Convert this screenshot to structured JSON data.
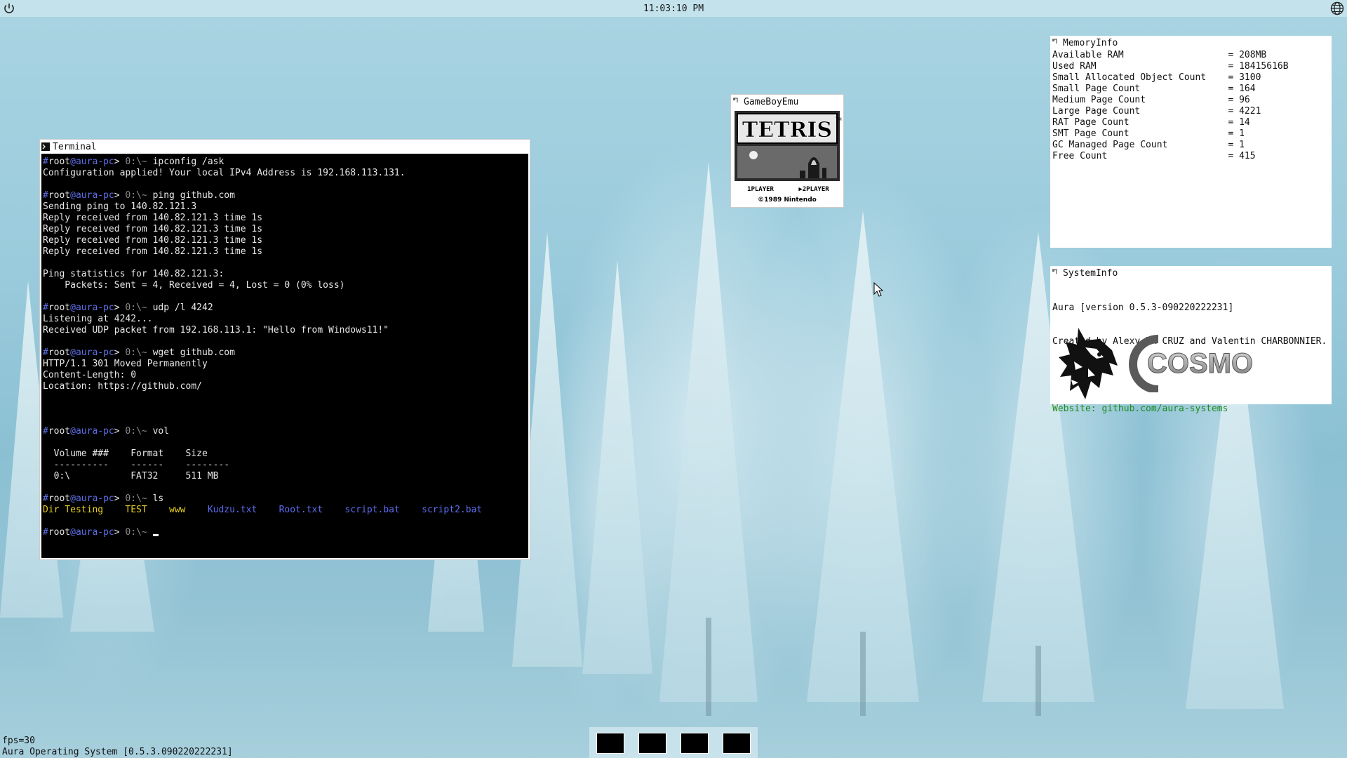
{
  "topbar": {
    "clock": "11:03:10 PM",
    "power_icon": "power-icon",
    "globe_icon": "globe-icon"
  },
  "terminal": {
    "title": "Terminal",
    "prompt": {
      "hash": "#",
      "user": "root",
      "host": "@aura-pc",
      "sep": ">",
      "path": " 0:\\~ "
    },
    "blocks": [
      {
        "cmd": "ipconfig /ask",
        "output": [
          "Configuration applied! Your local IPv4 Address is 192.168.113.131."
        ]
      },
      {
        "cmd": "ping github.com",
        "output": [
          "Sending ping to 140.82.121.3",
          "Reply received from 140.82.121.3 time 1s",
          "Reply received from 140.82.121.3 time 1s",
          "Reply received from 140.82.121.3 time 1s",
          "Reply received from 140.82.121.3 time 1s",
          "",
          "Ping statistics for 140.82.121.3:",
          "    Packets: Sent = 4, Received = 4, Lost = 0 (0% loss)"
        ]
      },
      {
        "cmd": "udp /l 4242",
        "output": [
          "Listening at 4242...",
          "Received UDP packet from 192.168.113.1: \"Hello from Windows11!\""
        ]
      },
      {
        "cmd": "wget github.com",
        "output": [
          "HTTP/1.1 301 Moved Permanently",
          "Content-Length: 0",
          "Location: https://github.com/"
        ]
      },
      {
        "cmd": "vol",
        "output": [
          "",
          "  Volume ###    Format    Size",
          "  ----------    ------    --------",
          "  0:\\           FAT32     511 MB"
        ]
      },
      {
        "cmd": "ls",
        "output": []
      }
    ],
    "ls_entries": [
      {
        "name": "Dir Testing",
        "color": "#e8d020"
      },
      {
        "name": "TEST",
        "color": "#e8d020"
      },
      {
        "name": "www",
        "color": "#e8d020"
      },
      {
        "name": "Kudzu.txt",
        "color": "#5d6cf0"
      },
      {
        "name": "Root.txt",
        "color": "#5d6cf0"
      },
      {
        "name": "script.bat",
        "color": "#5d6cf0"
      },
      {
        "name": "script2.bat",
        "color": "#5d6cf0"
      }
    ]
  },
  "gameboy": {
    "title": "GameBoyEmu",
    "game_title": "TETRIS",
    "tm": "TM",
    "player1": "1PLAYER",
    "player2": "▶2PLAYER",
    "copyright": "©1989 Nintendo"
  },
  "memoryinfo": {
    "title": "MemoryInfo",
    "rows": [
      {
        "label": "Available RAM",
        "value": "208MB"
      },
      {
        "label": "Used RAM",
        "value": "18415616B"
      },
      {
        "label": "Small Allocated Object Count",
        "value": "3100"
      },
      {
        "label": "Small Page Count",
        "value": "164"
      },
      {
        "label": "Medium Page Count",
        "value": "96"
      },
      {
        "label": "Large Page Count",
        "value": "4221"
      },
      {
        "label": "RAT Page Count",
        "value": "14"
      },
      {
        "label": "SMT Page Count",
        "value": "1"
      },
      {
        "label": "GC Managed Page Count",
        "value": "1"
      },
      {
        "label": "Free Count",
        "value": "415"
      }
    ]
  },
  "systeminfo": {
    "title": "SystemInfo",
    "version_line": "Aura [version 0.5.3-090220222231]",
    "credits": "Created by Alexy DA CRUZ and Valentin CHARBONNIER.",
    "website": "Website: github.com/aura-systems",
    "logo_text": "COSMOS"
  },
  "taskbar": {
    "item_count": 4
  },
  "status": {
    "fps": "fps=30",
    "os_version": "Aura Operating System [0.5.3.090220222231]"
  },
  "colors": {
    "prompt": "#5f6fe8",
    "path": "#8a8a8a",
    "dir": "#e8d020",
    "file": "#5d6cf0",
    "website": "#1e8c1e"
  }
}
